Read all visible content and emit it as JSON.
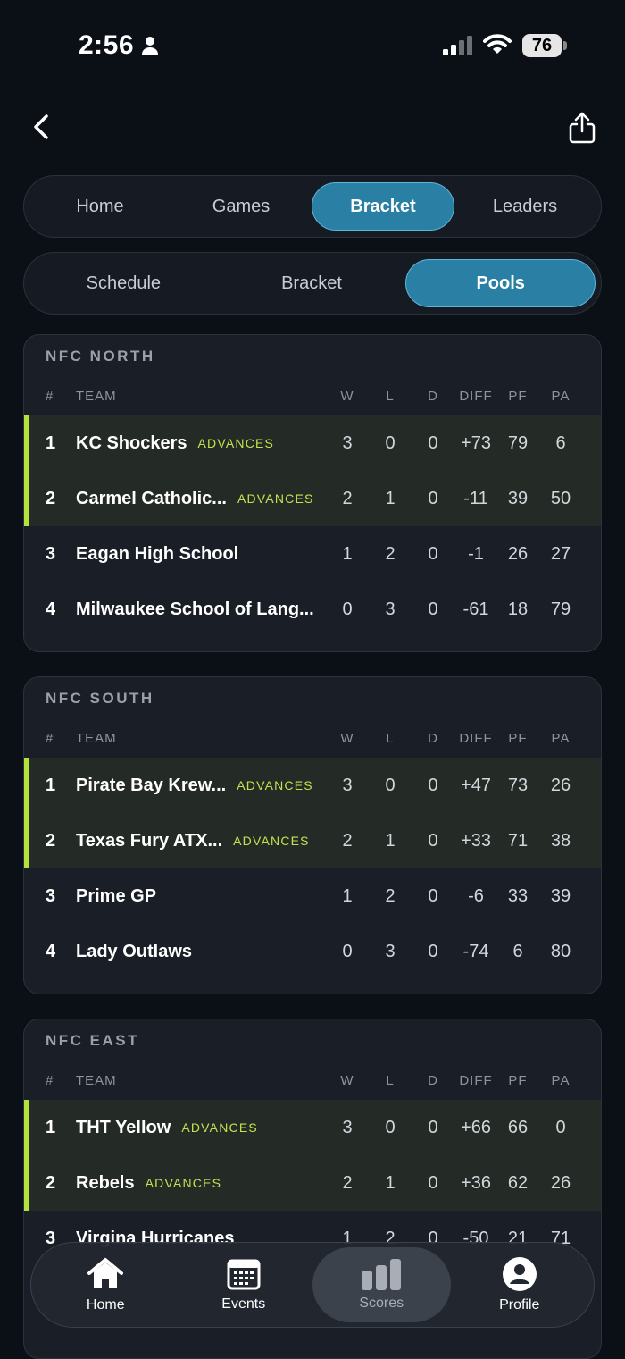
{
  "status": {
    "time": "2:56",
    "battery": "76"
  },
  "tabs_top": [
    {
      "label": "Home",
      "active": false
    },
    {
      "label": "Games",
      "active": false
    },
    {
      "label": "Bracket",
      "active": true
    },
    {
      "label": "Leaders",
      "active": false
    }
  ],
  "tabs_sub": [
    {
      "label": "Schedule",
      "active": false
    },
    {
      "label": "Bracket",
      "active": false
    },
    {
      "label": "Pools",
      "active": true
    }
  ],
  "columns": {
    "rank": "#",
    "team": "TEAM",
    "w": "W",
    "l": "L",
    "d": "D",
    "diff": "DIFF",
    "pf": "PF",
    "pa": "PA"
  },
  "advance_label": "ADVANCES",
  "pools": [
    {
      "name": "NFC NORTH",
      "teams": [
        {
          "rank": "1",
          "name": "KC Shockers",
          "advances": true,
          "w": "3",
          "l": "0",
          "d": "0",
          "diff": "+73",
          "pf": "79",
          "pa": "6"
        },
        {
          "rank": "2",
          "name": "Carmel Catholic...",
          "advances": true,
          "w": "2",
          "l": "1",
          "d": "0",
          "diff": "-11",
          "pf": "39",
          "pa": "50"
        },
        {
          "rank": "3",
          "name": "Eagan High School",
          "advances": false,
          "w": "1",
          "l": "2",
          "d": "0",
          "diff": "-1",
          "pf": "26",
          "pa": "27"
        },
        {
          "rank": "4",
          "name": "Milwaukee School of Lang...",
          "advances": false,
          "w": "0",
          "l": "3",
          "d": "0",
          "diff": "-61",
          "pf": "18",
          "pa": "79"
        }
      ]
    },
    {
      "name": "NFC SOUTH",
      "teams": [
        {
          "rank": "1",
          "name": "Pirate Bay Krew...",
          "advances": true,
          "w": "3",
          "l": "0",
          "d": "0",
          "diff": "+47",
          "pf": "73",
          "pa": "26"
        },
        {
          "rank": "2",
          "name": "Texas Fury ATX...",
          "advances": true,
          "w": "2",
          "l": "1",
          "d": "0",
          "diff": "+33",
          "pf": "71",
          "pa": "38"
        },
        {
          "rank": "3",
          "name": "Prime GP",
          "advances": false,
          "w": "1",
          "l": "2",
          "d": "0",
          "diff": "-6",
          "pf": "33",
          "pa": "39"
        },
        {
          "rank": "4",
          "name": "Lady Outlaws",
          "advances": false,
          "w": "0",
          "l": "3",
          "d": "0",
          "diff": "-74",
          "pf": "6",
          "pa": "80"
        }
      ]
    },
    {
      "name": "NFC EAST",
      "teams": [
        {
          "rank": "1",
          "name": "THT Yellow",
          "advances": true,
          "w": "3",
          "l": "0",
          "d": "0",
          "diff": "+66",
          "pf": "66",
          "pa": "0"
        },
        {
          "rank": "2",
          "name": "Rebels",
          "advances": true,
          "w": "2",
          "l": "1",
          "d": "0",
          "diff": "+36",
          "pf": "62",
          "pa": "26"
        },
        {
          "rank": "3",
          "name": "Virgina Hurricanes",
          "advances": false,
          "w": "1",
          "l": "2",
          "d": "0",
          "diff": "-50",
          "pf": "21",
          "pa": "71"
        }
      ]
    }
  ],
  "bottom_nav": [
    {
      "label": "Home",
      "icon": "house-icon",
      "active": false
    },
    {
      "label": "Events",
      "icon": "calendar-icon",
      "active": false
    },
    {
      "label": "Scores",
      "icon": "bar-chart-icon",
      "active": true
    },
    {
      "label": "Profile",
      "icon": "person-circle-icon",
      "active": false
    }
  ],
  "colors": {
    "accent": "#2a7fa5",
    "advance": "#b4e23d",
    "background": "#0b0f16",
    "card": "#1a1f27"
  }
}
